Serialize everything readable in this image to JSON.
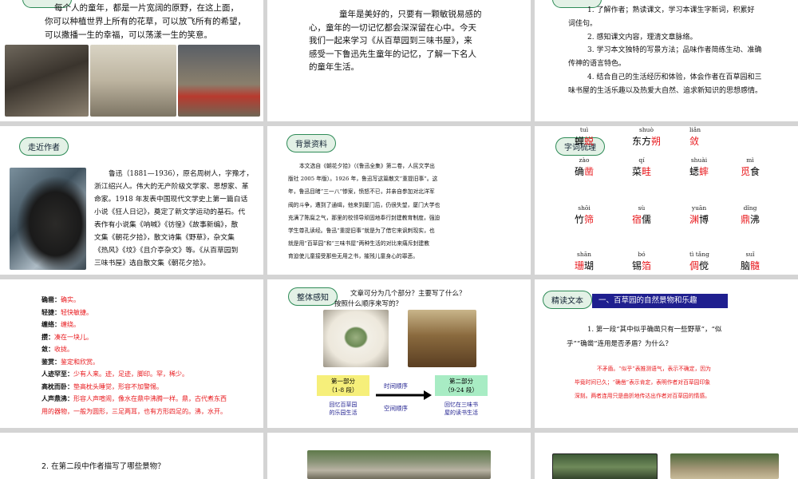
{
  "s1": {
    "lines": [
      "每个人的童年，都是一片宽阔的原野，在这上面，",
      "你可以种植世界上所有的花草，可以放飞所有的希望，",
      "可以撒播一生的幸福，可以荡漾一生的笑意。"
    ]
  },
  "s2": {
    "lines": [
      "童年是美好的，只要有一颗敏锐易感的",
      "心，童年的一切记忆都会深深留在心中。今天",
      "我们一起来学习《从百草园到三味书屋》，来",
      "感受一下鲁迅先生童年的记忆，了解一下名人",
      "的童年生活。"
    ]
  },
  "s3": {
    "items": [
      "1. 了解作者；熟读课文，学习本课生字新词，积累好",
      "词佳句。",
      "2. 感知课文内容，理清文章脉络。",
      "3. 学习本文独特的写景方法；品味作者简练生动、准确",
      "传神的语言特色。",
      "4. 结合自己的生活经历和体验，体会作者在百草园和三",
      "味书屋的生活乐趣以及热爱大自然、追求新知识的思想感情。"
    ]
  },
  "s4": {
    "badge": "走近作者",
    "lines": [
      "鲁迅（1881—1936），原名周树人，字豫才，",
      "浙江绍兴人。伟大的无产阶级文学家、思想家、革",
      "命家。1918 年发表中国现代文学史上第一篇白话",
      "小说《狂人日记》，奠定了新文学运动的基石。代",
      "表作有小说集《呐喊》《彷徨》《故事新编》，散",
      "文集《朝花夕拾》，散文诗集《野草》，杂文集",
      "《热风》《坟》《且介亭杂文》等。《从百草园到",
      "三味书屋》选自散文集《朝花夕拾》。"
    ]
  },
  "s5": {
    "badge": "背景资料",
    "lines": [
      "本文选自《朝花夕拾》（《鲁迅全集》第二卷，人民文学出",
      "版社 2005 年版）。1926 年，鲁迅写这篇散文“重提旧事”。这",
      "年，鲁迅目睹“三一八”惨案，愤怒不已，并亲自参加对北洋军",
      "阀的斗争，遭到了通缉，他来到厦门后，仍很失望，厦门大学也",
      "充满了陈腐之气，那里的校领导顽固地奉行封建教育制度，强迫",
      "学生尊孔读经。鲁迅“重提旧事”就是为了借它来讽刺现实，也",
      "就是用“百草园”和“三味书屋”两种生活的对比来痛斥封建教",
      "育迫使儿童接受那些无用之书，摧残儿童身心的罪恶。"
    ]
  },
  "s6": {
    "badge": "字词梳理",
    "words": [
      {
        "py": "zào",
        "pre": "确",
        "red": "凿",
        "post": ""
      },
      {
        "py": "qí",
        "pre": "菜",
        "red": "畦",
        "post": ""
      },
      {
        "py": "shuài",
        "pre": "蟋",
        "red": "蟀",
        "post": ""
      },
      {
        "py": "mì",
        "pre": "",
        "red": "觅",
        "post": "食"
      },
      {
        "py": "shōi",
        "pre": "竹",
        "red": "筛",
        "post": ""
      },
      {
        "py": "sù",
        "pre": "",
        "red": "宿",
        "post": "儒"
      },
      {
        "py": "yuān",
        "pre": "",
        "red": "渊",
        "post": "博"
      },
      {
        "py": "dǐng",
        "pre": "",
        "red": "鼎",
        "post": "沸"
      },
      {
        "py": "shān",
        "pre": "",
        "red": "珊",
        "post": "瑚"
      },
      {
        "py": "bó",
        "pre": "锡",
        "red": "箔",
        "post": ""
      },
      {
        "py": "tì tǎng",
        "pre": "",
        "red": "倜",
        "post": "傥"
      },
      {
        "py": "suǐ",
        "pre": "脑",
        "red": "髓",
        "post": ""
      },
      {
        "py": "tuì",
        "pre": "蝉",
        "red": "蜕",
        "post": ""
      },
      {
        "py": "shuò",
        "pre": "东方",
        "red": "朔",
        "post": ""
      },
      {
        "py": "liǎn",
        "pre": "",
        "red": "敛",
        "post": ""
      }
    ]
  },
  "s7": {
    "entries": [
      {
        "t": "确凿：",
        "d": "确实。"
      },
      {
        "t": "轻捷：",
        "d": "轻快敏捷。"
      },
      {
        "t": "缠络：",
        "d": "缠绕。"
      },
      {
        "t": "攒：",
        "d": "凑在一块儿。"
      },
      {
        "t": "敛：",
        "d": "收拢。"
      },
      {
        "t": "鉴赏：",
        "d": "鉴定和欣赏。"
      },
      {
        "t": "人迹罕至：",
        "d": "少有人来。迹，足迹，脚印。罕，稀少。"
      },
      {
        "t": "高枕而卧：",
        "d": "垫高枕头睡觉，形容不加警惕。"
      },
      {
        "t": "人声鼎沸：",
        "d": "形容人声喧闹，像水在鼎中沸腾一样。鼎，古代煮东西"
      },
      {
        "t": "",
        "d": "用的器物，一般为圆形，三足两耳，也有方形四足的。沸，水开。"
      }
    ]
  },
  "s8": {
    "badge": "整体感知",
    "question1": "文章可分为几个部分？主要写了什么？",
    "question2": "按照什么顺序来写的？",
    "box1a": "第一部分",
    "box1b": "（1-8 段）",
    "box2a": "第二部分",
    "box2b": "（9-24 段）",
    "order1": "时间顺序",
    "order2": "空间顺序",
    "cap1a": "回忆百草园",
    "cap1b": "的乐园生活",
    "cap2a": "回忆在三味书",
    "cap2b": "屋的读书生活"
  },
  "s9": {
    "badge": "精读文本",
    "header": "一、百草园的自然景物和乐趣",
    "qLines": [
      "1. 第一段“其中似乎确凿只有一些野草”，“似",
      "乎”“确凿”连用是否矛盾？为什么？"
    ],
    "aLines": [
      "不矛盾。“似乎”表推测语气，表示不确定，因为",
      "毕竟时间已久；“确凿”表示肯定，表明作者对百草园印象",
      "深刻。两者连用只是曲折地传达出作者对百草园的情感。"
    ]
  },
  "s10": {
    "question": "2. 在第二段中作者描写了哪些景物？"
  },
  "colors": {
    "red": "#e8181c",
    "green": "#2e8b57",
    "navy": "#1f1f8f",
    "yellow": "#f6ef7a",
    "mint": "#a8ecc4"
  }
}
